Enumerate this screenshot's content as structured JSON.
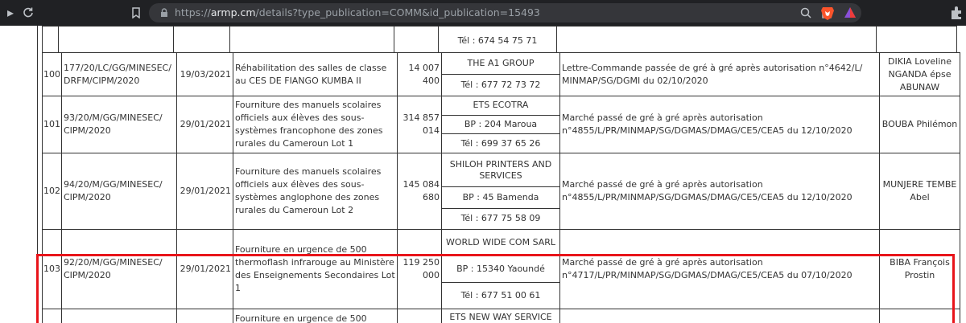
{
  "browser": {
    "url_prefix": "https://",
    "url_host": "armp.cm",
    "url_path": "/details?type_publication=COMM&id_publication=15493"
  },
  "partial_top": {
    "tel": "Tél : 674 54 75 71"
  },
  "rows": [
    {
      "num": "100",
      "ref": "177/20/LC/GG/MINESEC/\nDRFM/CIPM/2020",
      "date": "19/03/2021",
      "object": "Réhabilitation des salles de classe au CES DE FIANGO KUMBA II",
      "amount": "14 007\n400",
      "company": "THE A1 GROUP",
      "bp": "",
      "tel": "Tél : 677 72 73 72",
      "mode": "Lettre-Commande passée de gré à gré après autorisation n°4642/L/\nMINMAP/SG/DGMI du 02/10/2020",
      "holder": "DIKIA Loveline\nNGANDA épse\nABUNAW"
    },
    {
      "num": "101",
      "ref": "93/20/M/GG/MINESEC/\nCIPM/2020",
      "date": "29/01/2021",
      "object": "Fourniture des manuels scolaires officiels aux élèves des sous-systèmes francophone des zones rurales du Cameroun Lot 1",
      "amount": "314 857\n014",
      "company": "ETS ECOTRA",
      "bp": "BP : 204 Maroua",
      "tel": "Tél : 699 37 65 26",
      "mode": "Marché passé de gré à gré après autorisation\nn°4855/L/PR/MINMAP/SG/DGMAS/DMAG/CE5/CEA5 du 12/10/2020",
      "holder": "BOUBA Philémon"
    },
    {
      "num": "102",
      "ref": "94/20/M/GG/MINESEC/\nCIPM/2020",
      "date": "29/01/2021",
      "object": "Fourniture des manuels scolaires officiels aux élèves des sous-systèmes anglophone des zones rurales du Cameroun Lot 2",
      "amount": "145 084\n680",
      "company": "SHILOH PRINTERS AND SERVICES",
      "bp": "BP : 45 Bamenda",
      "tel": "Tél : 677 75 58 09",
      "mode": "Marché passé de gré à gré après autorisation\nn°4855/L/PR/MINMAP/SG/DGMAS/DMAG/CE5/CEA5 du 12/10/2020",
      "holder": "MUNJERE TEMBE\nAbel"
    },
    {
      "num": "103",
      "ref": "92/20/M/GG/MINESEC/\nCIPM/2020",
      "date": "29/01/2021",
      "object": "Fourniture en urgence de 500 thermoflash infrarouge au Ministère des Enseignements Secondaires Lot 1",
      "amount": "119 250\n000",
      "company": "WORLD WIDE COM SARL",
      "bp": "BP : 15340 Yaoundé",
      "tel": "Tél : 677 51 00 61",
      "mode": "Marché passé de gré à gré après autorisation\nn°4717/L/PR/MINMAP/SG/DGMAS/DMAG/CE5/CEA5 du 07/10/2020",
      "holder": "BIBA François\nProstin"
    }
  ],
  "partial_bottom": {
    "object": "Fourniture en urgence de 500",
    "company": "ETS NEW WAY SERVICE"
  }
}
